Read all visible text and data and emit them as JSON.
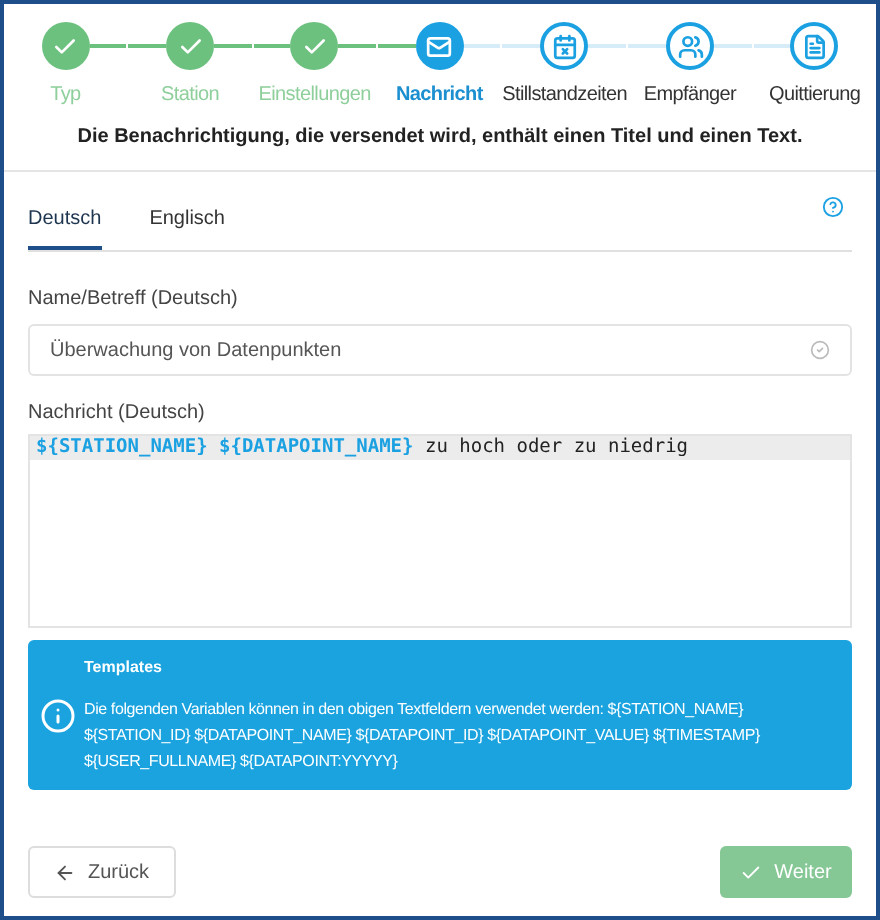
{
  "steps": [
    {
      "label": "Typ",
      "done": true,
      "selected": false,
      "kind": "check"
    },
    {
      "label": "Station",
      "done": true,
      "selected": false,
      "kind": "check"
    },
    {
      "label": "Einstellungen",
      "done": true,
      "selected": false,
      "kind": "check"
    },
    {
      "label": "Nachricht",
      "done": false,
      "selected": true,
      "kind": "mail"
    },
    {
      "label": "Stillstandzeiten",
      "done": false,
      "selected": false,
      "kind": "calendar"
    },
    {
      "label": "Empfänger",
      "done": false,
      "selected": false,
      "kind": "users"
    },
    {
      "label": "Quittierung",
      "done": false,
      "selected": false,
      "kind": "file"
    }
  ],
  "intro": "Die Benachrichtigung, die versendet wird, enthält einen Titel und einen Text.",
  "tabs": [
    {
      "label": "Deutsch",
      "selected": true
    },
    {
      "label": "Englisch",
      "selected": false
    }
  ],
  "name_field": {
    "label": "Name/Betreff (Deutsch)",
    "value": "Überwachung von Datenpunkten",
    "valid": true
  },
  "message_field": {
    "label": "Nachricht (Deutsch)",
    "segments": [
      {
        "text": "${STATION_NAME}",
        "kind": "variable"
      },
      {
        "text": "${DATAPOINT_NAME}",
        "kind": "variable"
      },
      {
        "text": "zu hoch oder zu niedrig",
        "kind": "text"
      }
    ]
  },
  "info": {
    "title": "Templates",
    "text": "Die folgenden Variablen können in den obigen Textfeldern verwendet werden: ${STATION_NAME} ${STATION_ID} ${DATAPOINT_NAME} ${DATAPOINT_ID} ${DATAPOINT_VALUE} ${TIMESTAMP} ${USER_FULLNAME} ${DATAPOINT:YYYYY}"
  },
  "back_button": {
    "label": "Zurück"
  },
  "next_button": {
    "label": "Weiter",
    "disabled": true
  }
}
